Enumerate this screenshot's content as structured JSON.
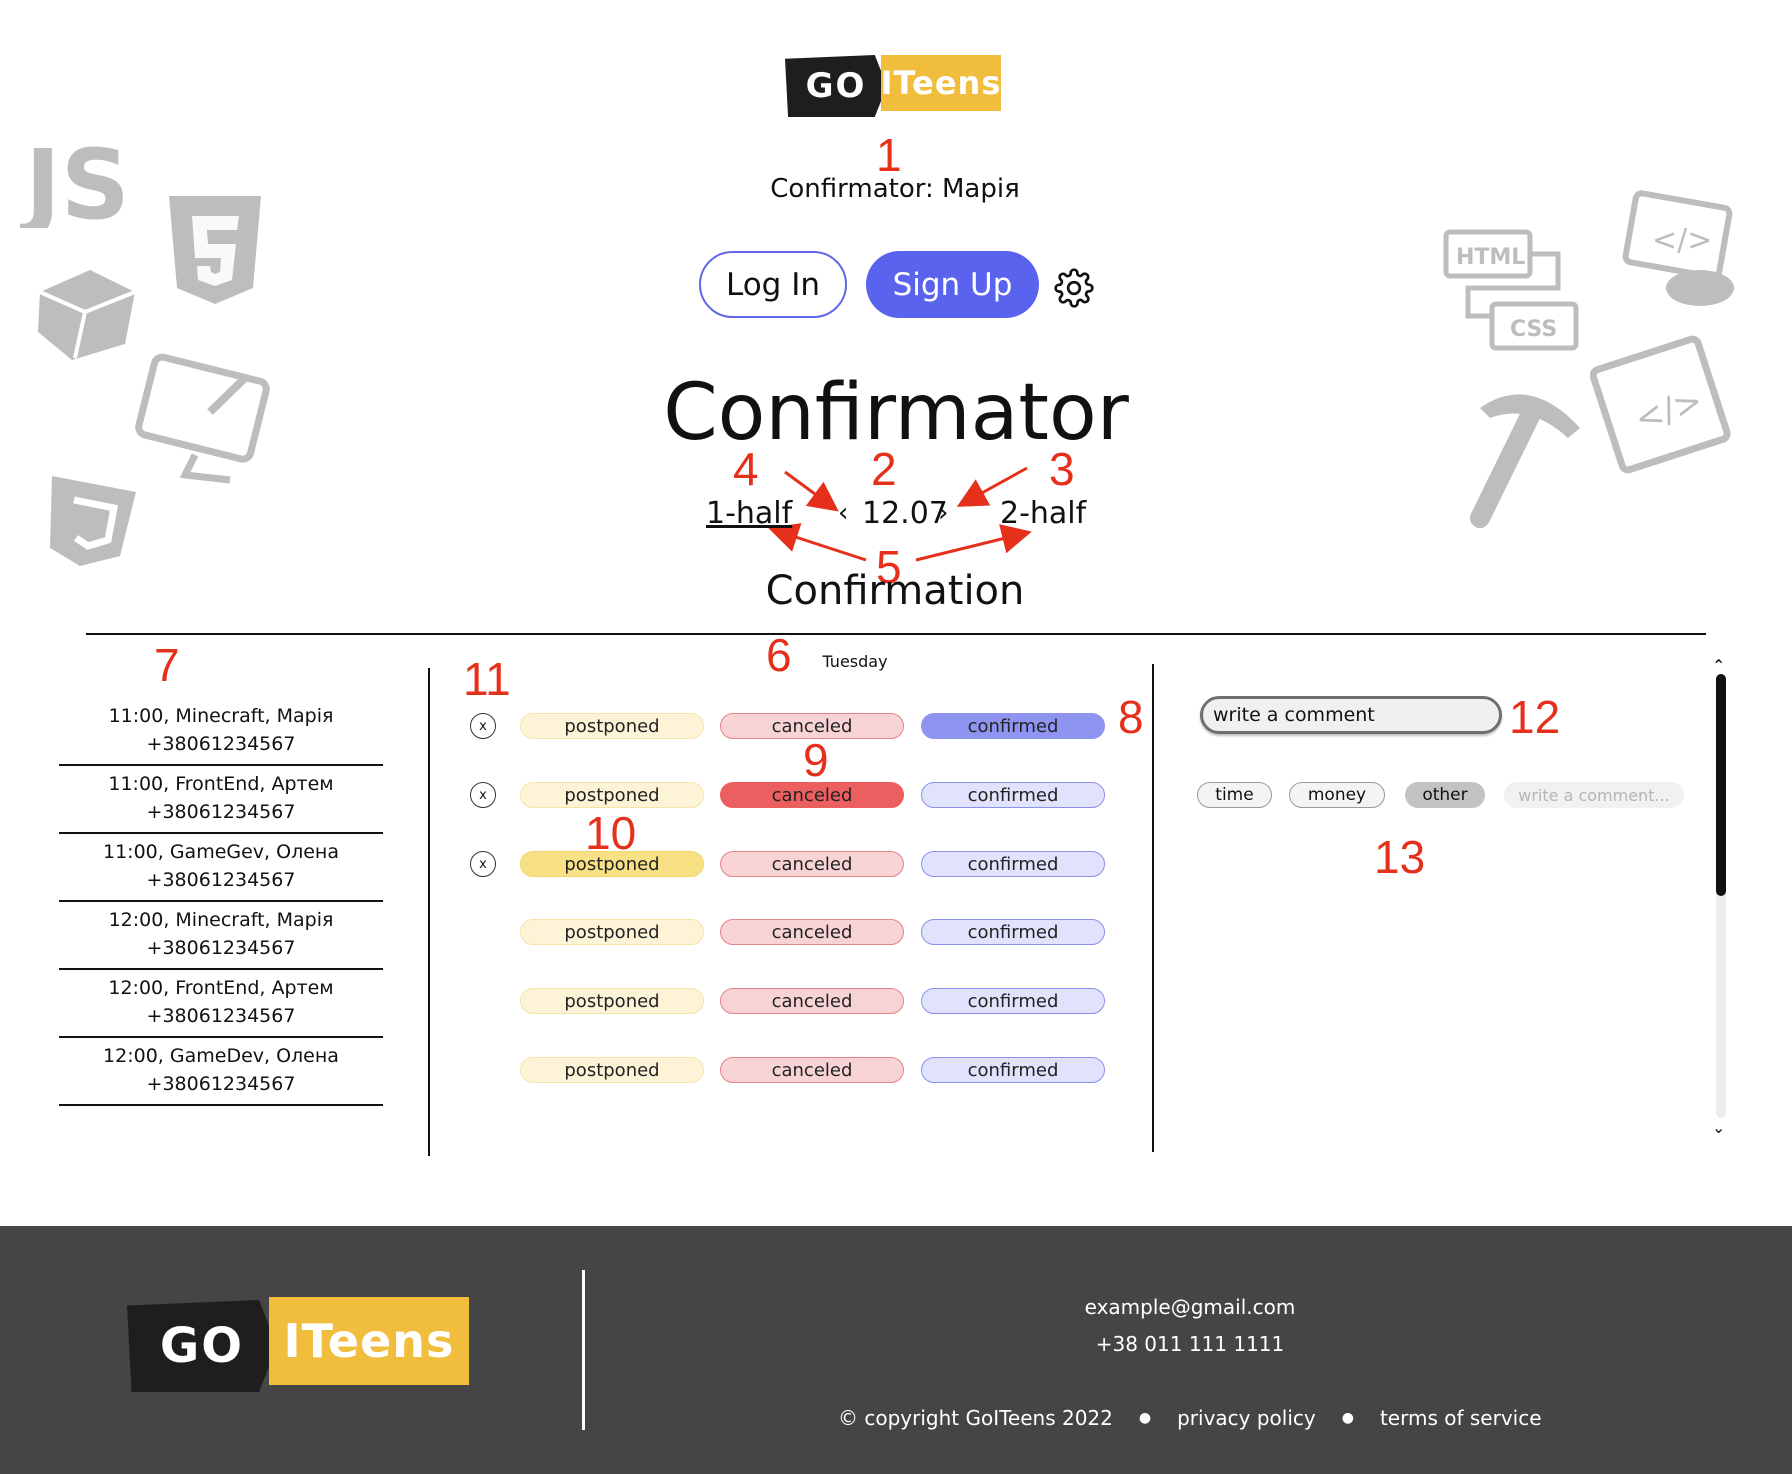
{
  "logo": {
    "go": "GO",
    "iteens": "ITeens"
  },
  "header": {
    "subtitle": "Confirmator: Марія",
    "login_label": "Log In",
    "signup_label": "Sign Up",
    "settings_icon": "gear-icon"
  },
  "title": "Confirmator",
  "date_nav": {
    "first_half": "1-half",
    "prev": "‹",
    "date": "12.07",
    "next": "›",
    "second_half": "2-half"
  },
  "section_title": "Confirmation",
  "day": "Tuesday",
  "annotations": [
    "1",
    "2",
    "3",
    "4",
    "5",
    "6",
    "7",
    "8",
    "9",
    "10",
    "11",
    "12",
    "13"
  ],
  "lessons": [
    {
      "line1": "11:00, Minecraft, Марія",
      "line2": "+38061234567"
    },
    {
      "line1": "11:00, FrontEnd, Артем",
      "line2": "+38061234567"
    },
    {
      "line1": "11:00, GameGev, Олена",
      "line2": "+38061234567"
    },
    {
      "line1": "12:00, Minecraft, Марія",
      "line2": "+38061234567"
    },
    {
      "line1": "12:00, FrontEnd, Артем",
      "line2": "+38061234567"
    },
    {
      "line1": "12:00, GameDev, Олена",
      "line2": "+38061234567"
    }
  ],
  "status_labels": {
    "postponed": "postponed",
    "canceled": "canceled",
    "confirmed": "confirmed",
    "clear": "x"
  },
  "status_rows": [
    {
      "selected": "confirmed",
      "has_clear": true
    },
    {
      "selected": "canceled",
      "has_clear": true
    },
    {
      "selected": "postponed",
      "has_clear": true
    },
    {
      "selected": "none",
      "has_clear": false
    },
    {
      "selected": "none",
      "has_clear": false
    },
    {
      "selected": "none",
      "has_clear": false
    }
  ],
  "comment": {
    "input_value": "write a comment",
    "tags": [
      "time",
      "money",
      "other"
    ],
    "tag_input_placeholder": "write a comment..."
  },
  "footer": {
    "email": "example@gmail.com",
    "phone": "+38 011 111 1111",
    "copyright": "© copyright GoITeens 2022",
    "privacy": "privacy policy",
    "terms": "terms of service"
  },
  "colors": {
    "accent": "#5a63ee",
    "postponed": "#f8e085",
    "canceled": "#ec5f60",
    "confirmed": "#8e94f0",
    "annotation": "#e5301c",
    "footer_bg": "#454545",
    "logo_yellow": "#f1bd3c"
  }
}
